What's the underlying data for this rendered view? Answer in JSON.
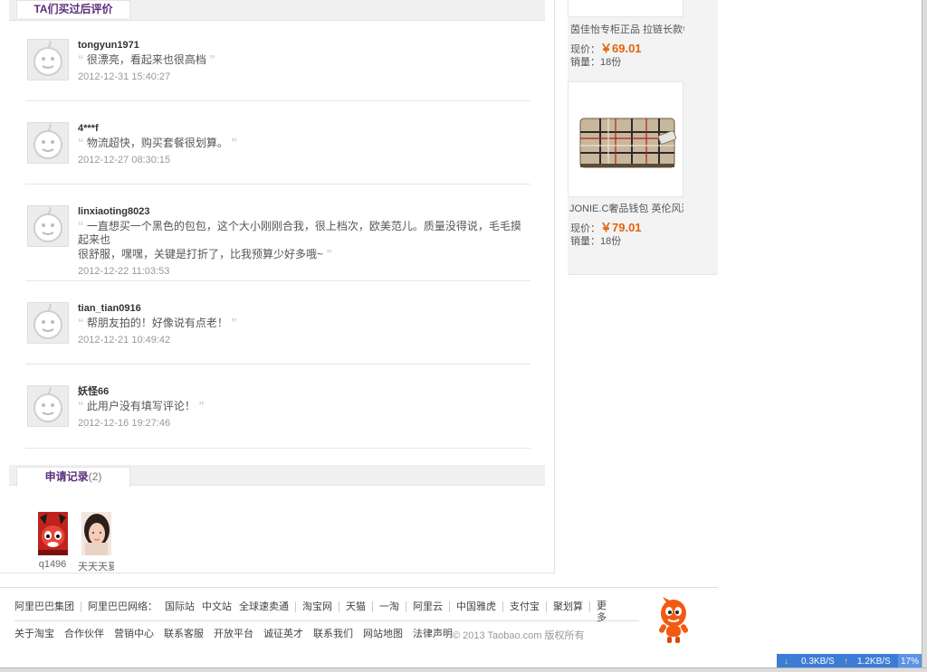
{
  "sections": {
    "reviews_tab": "TA们买过后评价",
    "records_tab": "申请记录",
    "records_count": "(2)"
  },
  "reviews": [
    {
      "user": "tongyun1971",
      "text": "很漂亮，看起来也很高档",
      "date": "2012-12-31 15:40:27"
    },
    {
      "user": "4***f",
      "text": "物流超快，购买套餐很划算。",
      "date": "2012-12-27 08:30:15"
    },
    {
      "user": "linxiaoting8023",
      "text_line1": "一直想买一个黑色的包包，这个大小刚刚合我，很上档次，欧美范儿。质量没得说，毛毛摸起来也",
      "text_line2": "很舒服，嘿嘿，关键是打折了，比我预算少好多哦~",
      "date": "2012-12-22 11:03:53"
    },
    {
      "user": "tian_tian0916",
      "text": "帮朋友拍的！好像说有点老！",
      "date": "2012-12-21 10:49:42"
    },
    {
      "user": "妖怪66",
      "text": "此用户没有填写评论！",
      "date": "2012-12-16 19:27:46"
    }
  ],
  "records": [
    {
      "name": "q1496"
    },
    {
      "name": "天天天夏"
    }
  ],
  "products": [
    {
      "title": "茵佳怡专柜正品 拉链长款牛皮",
      "price_label": "现价：",
      "price": "￥69.01",
      "sales_label": "销量：",
      "sales": "18份"
    },
    {
      "title": "JONIE.C奢品钱包 英伦风潮女",
      "price_label": "现价：",
      "price": "￥79.01",
      "sales_label": "销量：",
      "sales": "18份"
    }
  ],
  "footer": {
    "row1": [
      "阿里巴巴集团",
      "阿里巴巴网络：",
      "国际站",
      "中文站",
      "全球速卖通",
      "淘宝网",
      "天猫",
      "一淘",
      "阿里云",
      "中国雅虎",
      "支付宝",
      "聚划算",
      "更多"
    ],
    "row2": [
      "关于淘宝",
      "合作伙伴",
      "营销中心",
      "联系客服",
      "开放平台",
      "诚征英才",
      "联系我们",
      "网站地图",
      "法律声明"
    ],
    "copyright": "© 2013 Taobao.com 版权所有"
  },
  "netbar": {
    "down": "0.3KB/S",
    "up": "1.2KB/S",
    "percent": "17%"
  },
  "colors": {
    "accent_purple": "#5a2f7c",
    "price_orange": "#e4630c",
    "netbar_blue": "#3d7cd6"
  }
}
